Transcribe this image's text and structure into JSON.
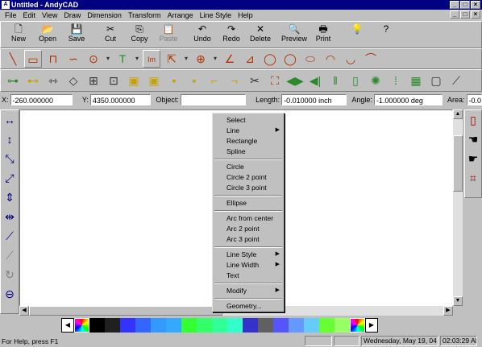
{
  "window": {
    "title": "Untitled - AndyCAD",
    "minimize": "_",
    "maximize": "□",
    "close": "×"
  },
  "menu": [
    "File",
    "Edit",
    "View",
    "Draw",
    "Dimension",
    "Transform",
    "Arrange",
    "Line Style",
    "Help"
  ],
  "toolbar": [
    {
      "label": "New",
      "icon": "new-file-icon",
      "glyph": "🗋",
      "enabled": true
    },
    {
      "label": "Open",
      "icon": "open-folder-icon",
      "glyph": "📂",
      "enabled": true
    },
    {
      "label": "Save",
      "icon": "save-disk-icon",
      "glyph": "💾",
      "enabled": true
    },
    {
      "label": "Cut",
      "icon": "scissors-icon",
      "glyph": "✂",
      "enabled": true
    },
    {
      "label": "Copy",
      "icon": "copy-icon",
      "glyph": "⎘",
      "enabled": true
    },
    {
      "label": "Paste",
      "icon": "paste-icon",
      "glyph": "📋",
      "enabled": false
    },
    {
      "label": "Undo",
      "icon": "undo-icon",
      "glyph": "↶",
      "enabled": true
    },
    {
      "label": "Redo",
      "icon": "redo-icon",
      "glyph": "↷",
      "enabled": true
    },
    {
      "label": "Delete",
      "icon": "delete-x-icon",
      "glyph": "✕",
      "enabled": true
    },
    {
      "label": "Preview",
      "icon": "print-preview-icon",
      "glyph": "🔍",
      "enabled": true
    },
    {
      "label": "Print",
      "icon": "printer-icon",
      "glyph": "🖶",
      "enabled": true
    }
  ],
  "coords": {
    "x_label": "X:",
    "x_value": "-260.000000",
    "y_label": "Y:",
    "y_value": "4350.000000",
    "object_label": "Object:",
    "object_value": "",
    "length_label": "Length:",
    "length_value": "-0.010000 inch",
    "angle_label": "Angle:",
    "angle_value": "-1.000000 deg",
    "area_label": "Area:",
    "area_value": "-0.0"
  },
  "context_menu": [
    {
      "label": "Select",
      "submenu": false
    },
    {
      "label": "Line",
      "submenu": true
    },
    {
      "label": "Rectangle",
      "submenu": false
    },
    {
      "label": "Spline",
      "submenu": false
    },
    {
      "sep": true
    },
    {
      "label": "Circle",
      "submenu": false
    },
    {
      "label": "Circle 2 point",
      "submenu": false
    },
    {
      "label": "Circle 3 point",
      "submenu": false
    },
    {
      "sep": true
    },
    {
      "label": "Ellipse",
      "submenu": false
    },
    {
      "sep": true
    },
    {
      "label": "Arc from center",
      "submenu": false
    },
    {
      "label": "Arc 2 point",
      "submenu": false
    },
    {
      "label": "Arc 3 point",
      "submenu": false
    },
    {
      "sep": true
    },
    {
      "label": "Line Style",
      "submenu": true
    },
    {
      "label": "Line Width",
      "submenu": true
    },
    {
      "label": "Text",
      "submenu": false
    },
    {
      "sep": true
    },
    {
      "label": "Modify",
      "submenu": true
    },
    {
      "sep": true
    },
    {
      "label": "Geometry...",
      "submenu": false
    }
  ],
  "palette": {
    "colors": [
      "#000000",
      "#202020",
      "#3333ff",
      "#3366ff",
      "#3399ff",
      "#33aaff",
      "#33ff33",
      "#33ff66",
      "#33ff99",
      "#33ffcc",
      "#3333cc",
      "#606060",
      "#5555ff",
      "#6699ff",
      "#66ccff",
      "#66ff33",
      "#99ff66"
    ],
    "left_arrow": "◀",
    "right_arrow": "▶"
  },
  "status": {
    "help": "For Help, press F1",
    "date": "Wednesday, May 19, 04",
    "time": "02:03:29 AM"
  }
}
